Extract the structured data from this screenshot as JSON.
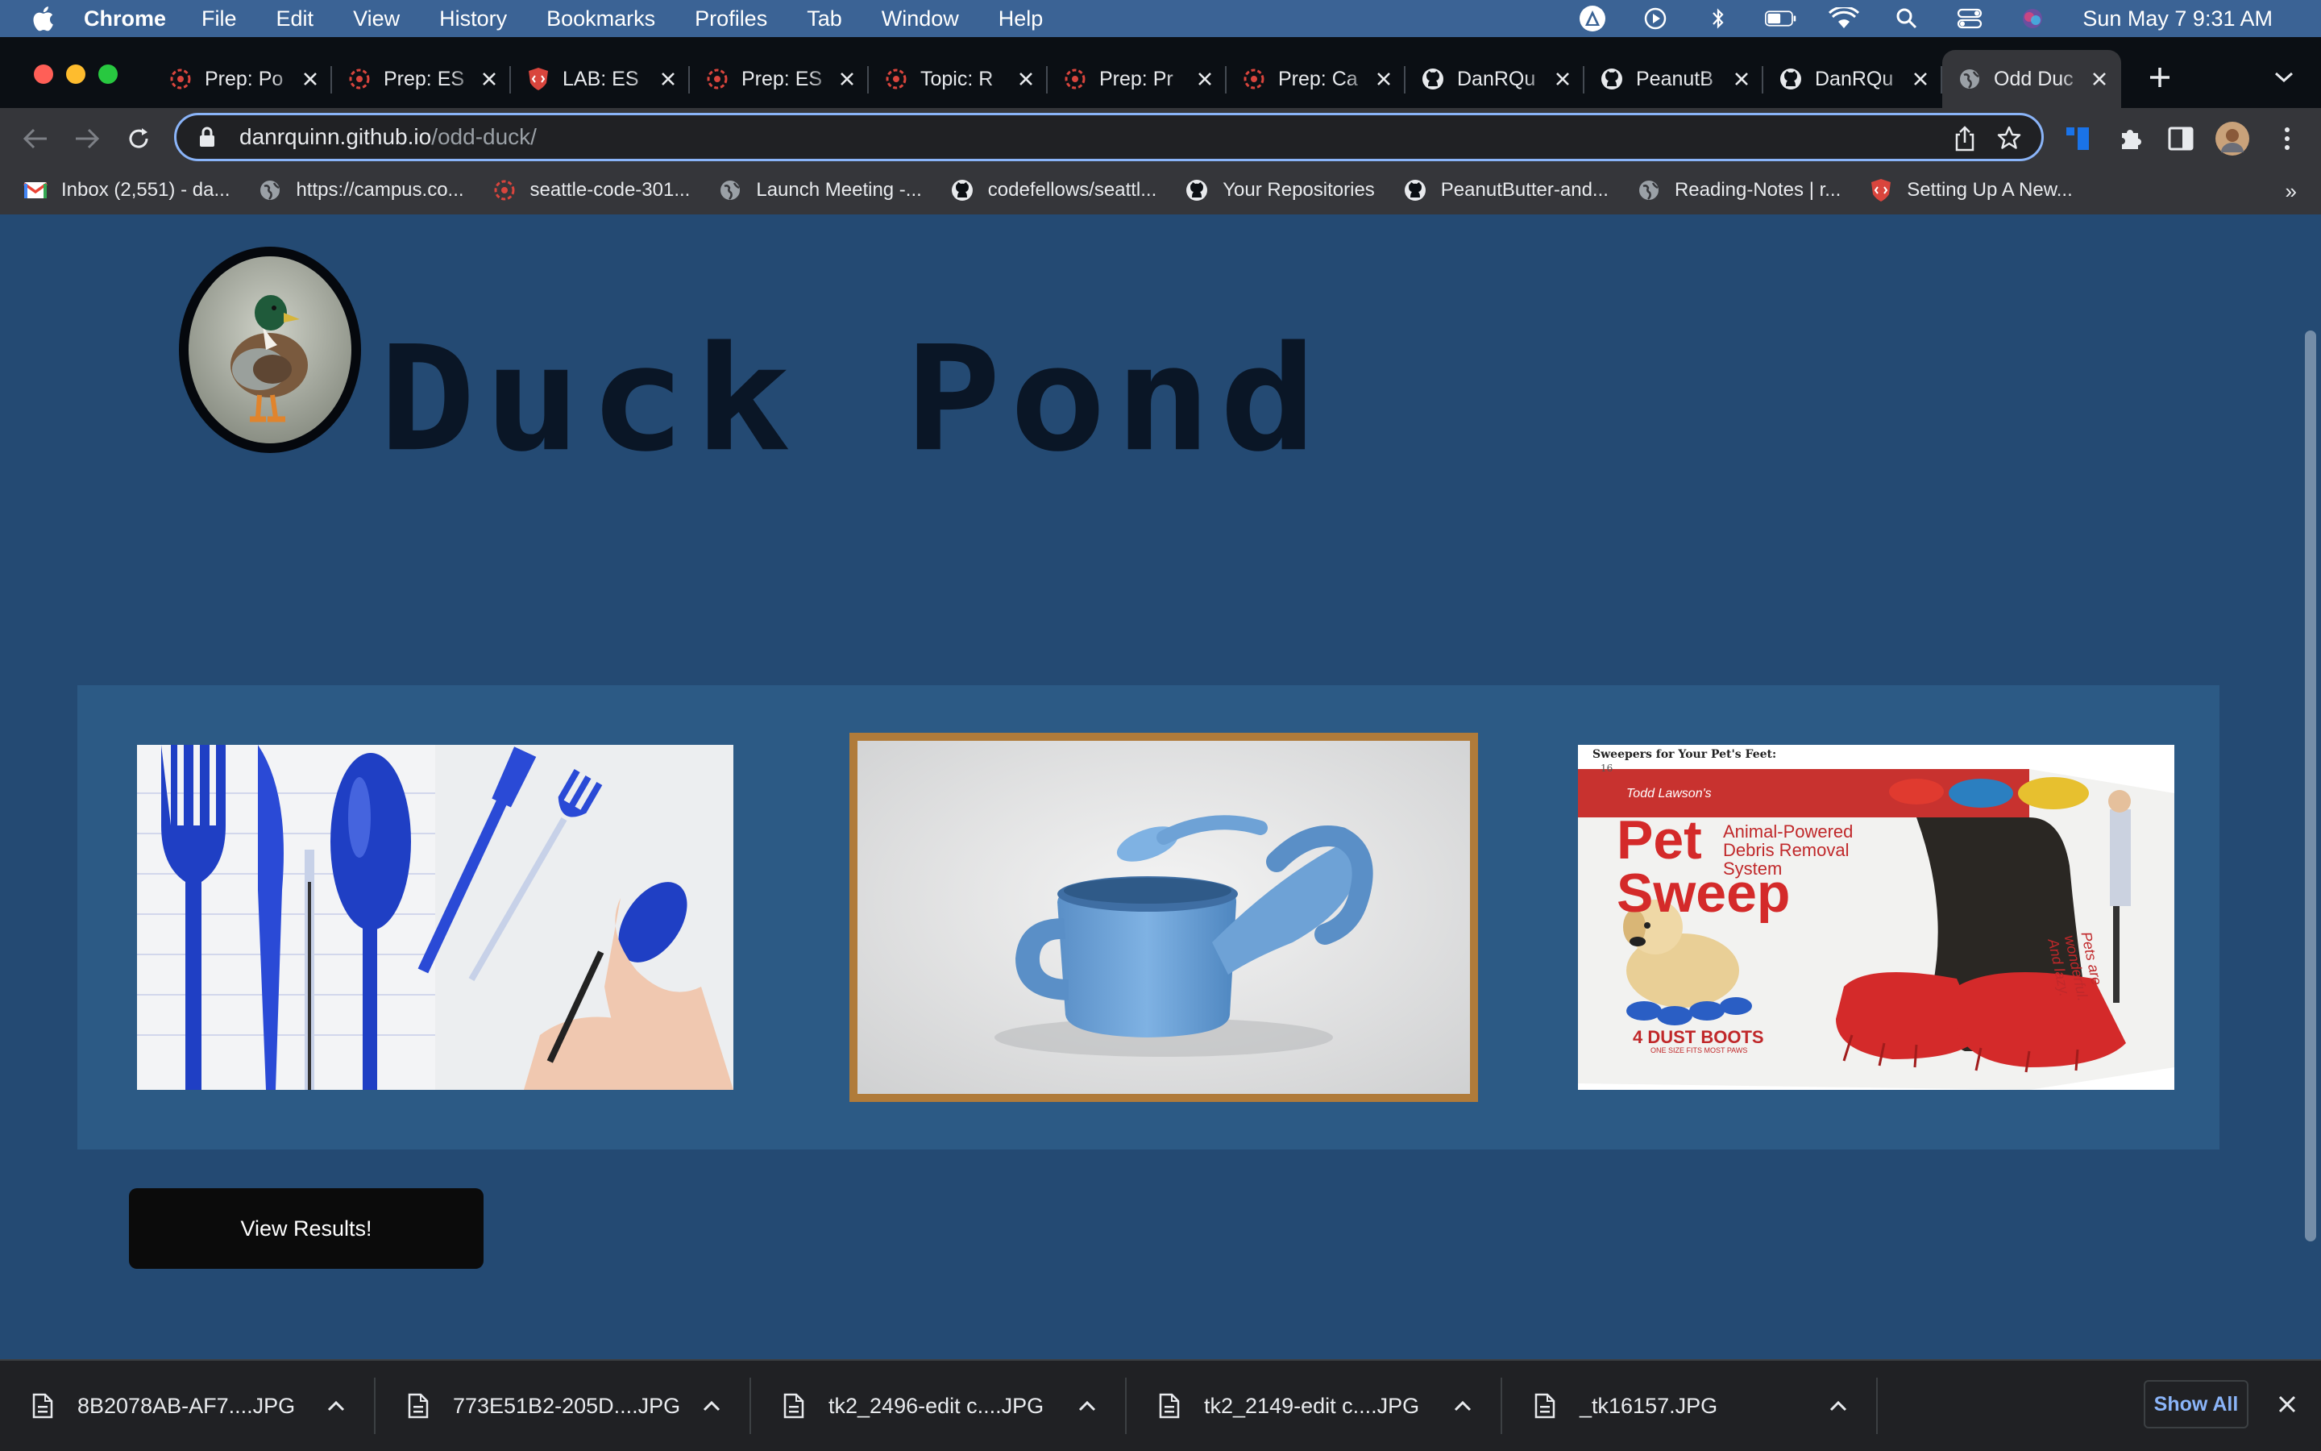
{
  "menubar": {
    "app": "Chrome",
    "items": [
      "File",
      "Edit",
      "View",
      "History",
      "Bookmarks",
      "Profiles",
      "Tab",
      "Window",
      "Help"
    ],
    "clock": "Sun May 7  9:31 AM"
  },
  "tabs": [
    {
      "label": "Prep: Po",
      "icon": "codefellows-icon"
    },
    {
      "label": "Prep: ES",
      "icon": "codefellows-icon"
    },
    {
      "label": "LAB: ES",
      "icon": "shield-code-icon"
    },
    {
      "label": "Prep: ES",
      "icon": "codefellows-icon"
    },
    {
      "label": "Topic: R",
      "icon": "codefellows-icon"
    },
    {
      "label": "Prep: Pr",
      "icon": "codefellows-icon"
    },
    {
      "label": "Prep: Ca",
      "icon": "codefellows-icon"
    },
    {
      "label": "DanRQu",
      "icon": "github-icon"
    },
    {
      "label": "PeanutB",
      "icon": "github-icon"
    },
    {
      "label": "DanRQu",
      "icon": "github-icon"
    },
    {
      "label": "Odd Duc",
      "icon": "globe-icon",
      "active": true
    }
  ],
  "address": {
    "host": "danrquinn.github.io",
    "path": "/odd-duck/"
  },
  "bookmarks": [
    {
      "label": "Inbox (2,551) - da...",
      "icon": "gmail-icon"
    },
    {
      "label": "https://campus.co...",
      "icon": "globe-icon"
    },
    {
      "label": "seattle-code-301...",
      "icon": "codefellows-icon"
    },
    {
      "label": "Launch Meeting -...",
      "icon": "globe-icon"
    },
    {
      "label": "codefellows/seattl...",
      "icon": "github-icon"
    },
    {
      "label": "Your Repositories",
      "icon": "github-icon"
    },
    {
      "label": "PeanutButter-and...",
      "icon": "github-icon"
    },
    {
      "label": "Reading-Notes | r...",
      "icon": "globe-icon"
    },
    {
      "label": "Setting Up A New...",
      "icon": "shield-code-icon"
    }
  ],
  "page": {
    "title": "Duck Pond",
    "products": [
      {
        "name": "pen-cutlery-product-image"
      },
      {
        "name": "watering-can-product-image",
        "selected": true
      },
      {
        "name": "pet-sweep-product-image"
      }
    ],
    "pet_sweep": {
      "caption": "Sweepers for Your Pet's Feet:",
      "page_number": "16",
      "brand": "Todd Lawson's",
      "headline_1": "Pet",
      "headline_2": "Sweep",
      "tagline": "Animal-Powered Debris Removal System",
      "boots": "4 DUST BOOTS",
      "boots_sub": "ONE SIZE FITS MOST PAWS",
      "side_text": "Pets are wonderful. And lazy."
    },
    "results_button": "View Results!"
  },
  "downloads": [
    "8B2078AB-AF7....JPG",
    "773E51B2-205D....JPG",
    "tk2_2496-edit c....JPG",
    "tk2_2149-edit c....JPG",
    "_tk16157.JPG"
  ],
  "downloads_show_all": "Show All",
  "colors": {
    "page_bg": "#244a73",
    "panel_bg": "#2c5a85",
    "selected_border": "#b07b3a",
    "title": "#0a1626",
    "accent": "#8ab4f8"
  }
}
